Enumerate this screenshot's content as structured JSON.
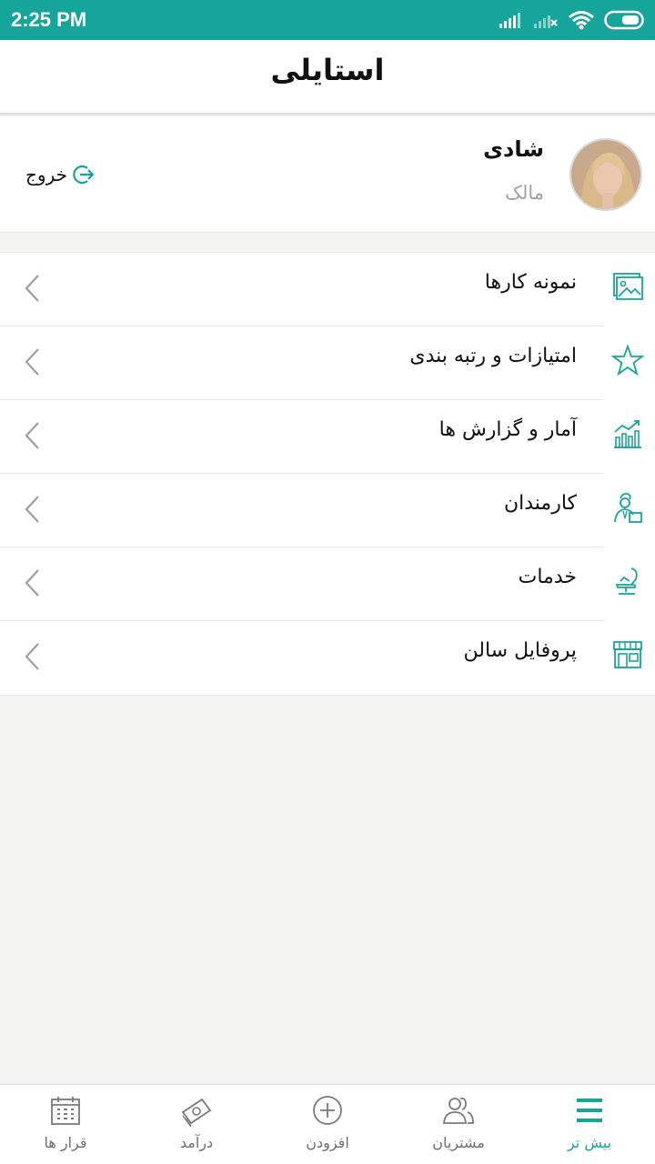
{
  "status_bar": {
    "time": "2:25 PM"
  },
  "header": {
    "title": "استایلی"
  },
  "profile": {
    "name": "شادی",
    "role": "مالک",
    "logout_label": "خروج"
  },
  "menu": {
    "items": [
      {
        "label": "نمونه کارها",
        "icon": "gallery-icon"
      },
      {
        "label": "امتیازات و رتبه بندی",
        "icon": "star-icon"
      },
      {
        "label": "آمار و گزارش ها",
        "icon": "chart-icon"
      },
      {
        "label": "کارمندان",
        "icon": "employee-icon"
      },
      {
        "label": "خدمات",
        "icon": "salon-chair-icon"
      },
      {
        "label": "پروفایل سالن",
        "icon": "storefront-icon"
      }
    ]
  },
  "bottom_nav": {
    "tabs": [
      {
        "label": "قرار ها",
        "icon": "calendar-icon",
        "active": false
      },
      {
        "label": "درآمد",
        "icon": "money-icon",
        "active": false
      },
      {
        "label": "افزودن",
        "icon": "add-circle-icon",
        "active": false
      },
      {
        "label": "مشتریان",
        "icon": "customers-icon",
        "active": false
      },
      {
        "label": "بیش تر",
        "icon": "menu-icon",
        "active": true
      }
    ]
  },
  "colors": {
    "accent": "#16a59a",
    "background": "#f4f4f2",
    "muted_text": "#a3a3a3"
  }
}
